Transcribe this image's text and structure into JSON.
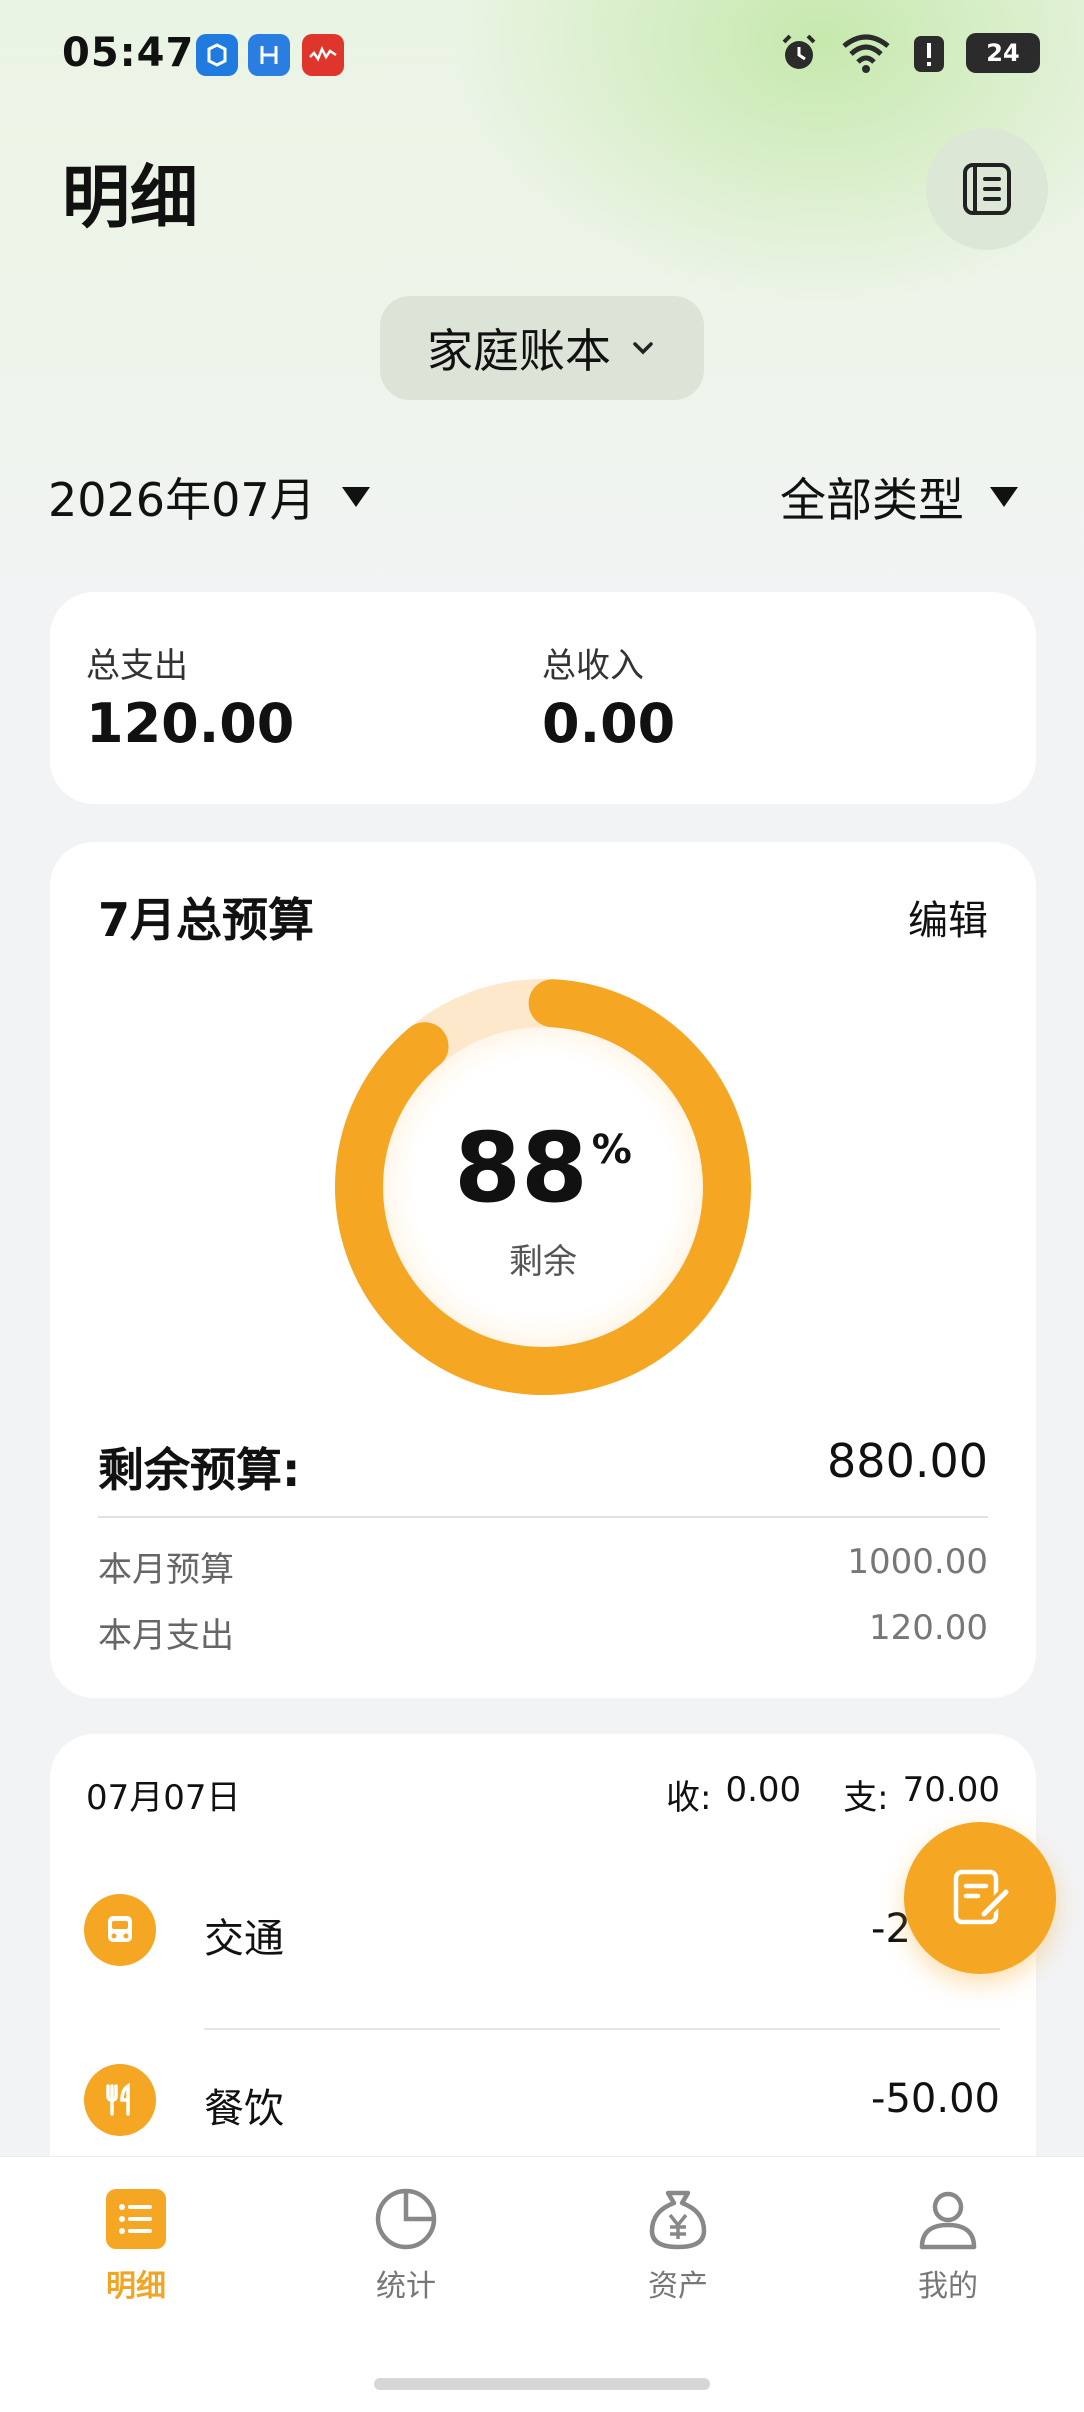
{
  "status_bar": {
    "time": "05:47",
    "battery": "24",
    "icons": [
      "alarm-icon",
      "wifi-icon",
      "alert-icon",
      "battery-icon"
    ]
  },
  "header": {
    "title": "明细",
    "book_icon": "ledger-book-icon"
  },
  "ledger": {
    "selected": "家庭账本"
  },
  "filters": {
    "month": "2026年07月",
    "type": "全部类型"
  },
  "summary": {
    "expense_label": "总支出",
    "expense_value": "120.00",
    "income_label": "总收入",
    "income_value": "0.00"
  },
  "budget": {
    "title": "7月总预算",
    "edit_label": "编辑",
    "percent_remaining": 88,
    "percent_text": "88",
    "percent_unit": "%",
    "ring_label": "剩余",
    "remaining_label": "剩余预算:",
    "remaining_value": "880.00",
    "monthly_budget_label": "本月预算",
    "monthly_budget_value": "1000.00",
    "monthly_expense_label": "本月支出",
    "monthly_expense_value": "120.00",
    "accent_color": "#f5a623",
    "track_color": "#fde8cc"
  },
  "transactions": {
    "date": "07月07日",
    "income_label": "收:",
    "income_value": "0.00",
    "expense_label": "支:",
    "expense_value": "70.00",
    "items": [
      {
        "icon": "bus-icon",
        "category": "交通",
        "amount": "-20.00"
      },
      {
        "icon": "utensils-icon",
        "category": "餐饮",
        "amount": "-50.00"
      }
    ]
  },
  "fab": {
    "icon": "edit-note-icon"
  },
  "bottom_nav": [
    {
      "label": "明细",
      "icon": "list-icon",
      "active": true
    },
    {
      "label": "统计",
      "icon": "pie-chart-icon",
      "active": false
    },
    {
      "label": "资产",
      "icon": "money-bag-icon",
      "active": false
    },
    {
      "label": "我的",
      "icon": "user-icon",
      "active": false
    }
  ]
}
